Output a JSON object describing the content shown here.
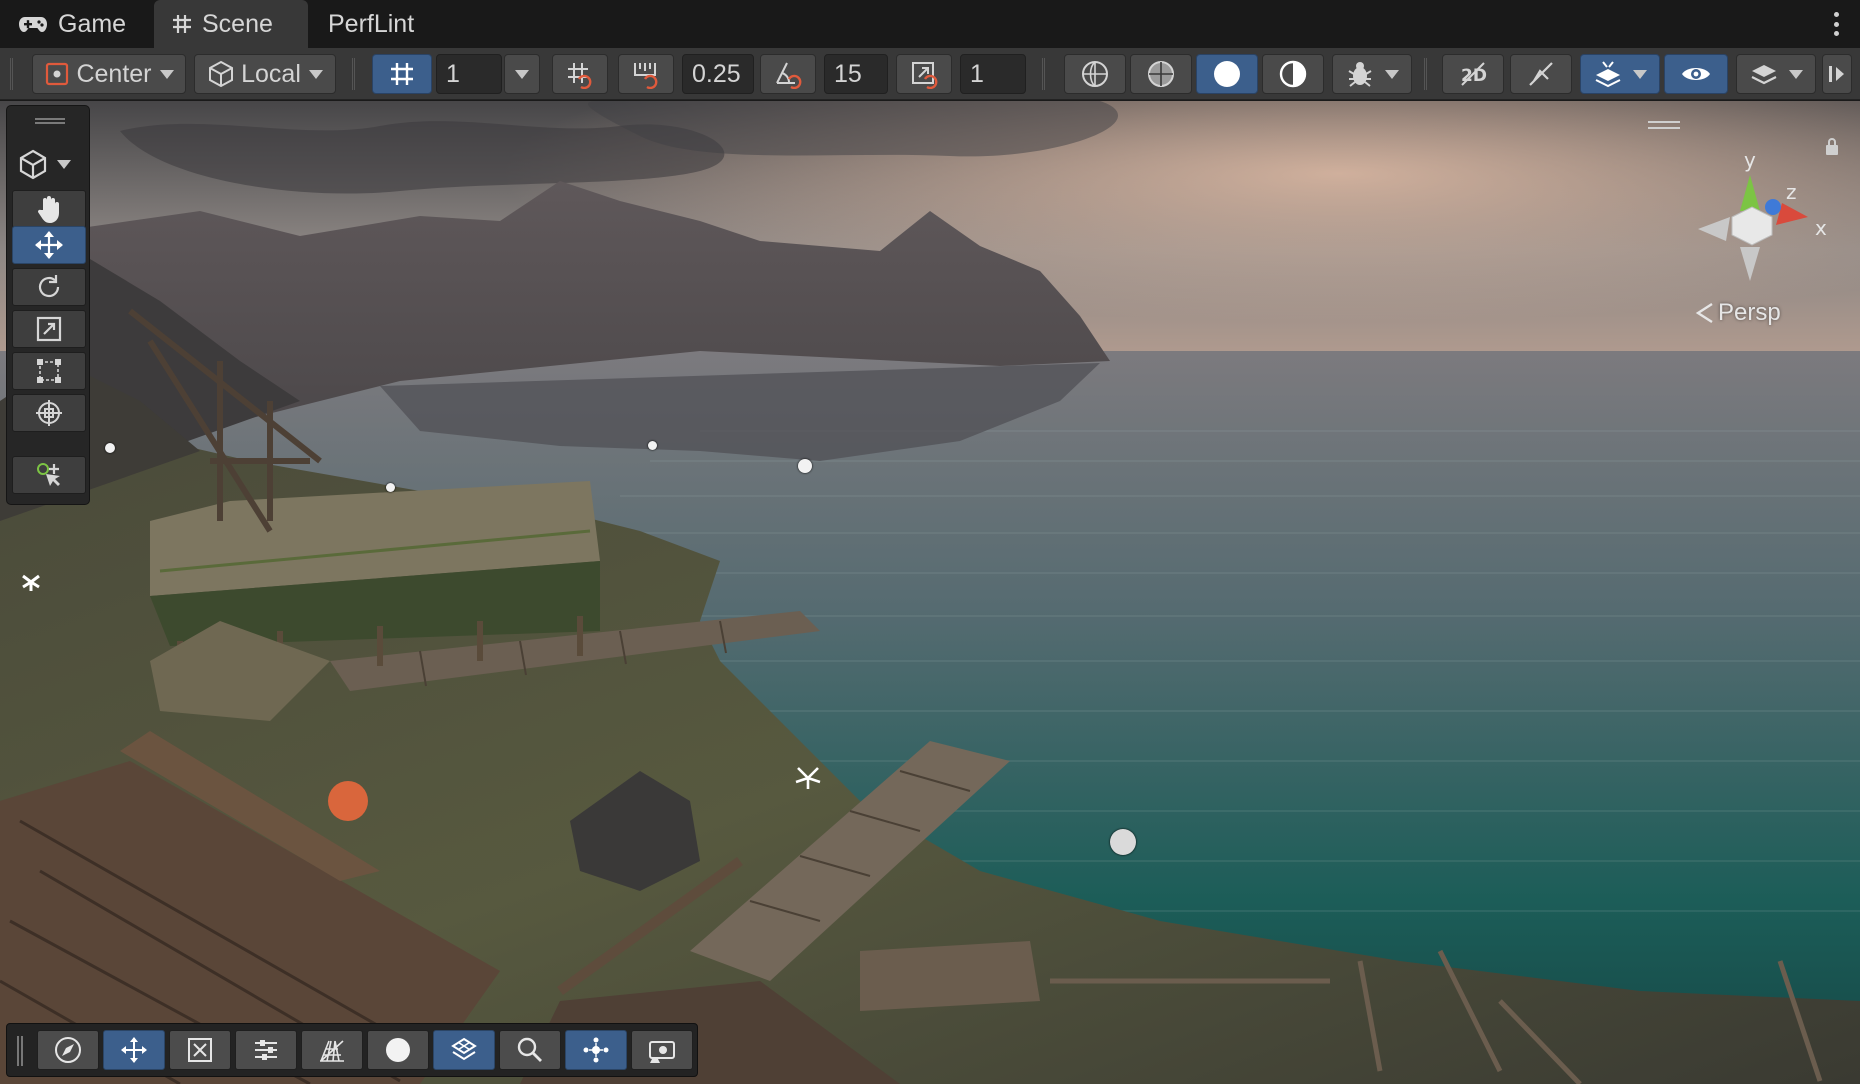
{
  "tabs": [
    {
      "label": "Game",
      "icon": "gamepad-icon"
    },
    {
      "label": "Scene",
      "icon": "grid-hash-icon"
    },
    {
      "label": "PerfLint",
      "icon": ""
    }
  ],
  "active_tab": "Scene",
  "toolbar": {
    "pivot_mode": "Center",
    "pivot_rotation": "Local",
    "grid_size_value": "1",
    "move_snap_value": "0.25",
    "rotate_snap_value": "15",
    "scale_snap_value": "1"
  },
  "scene_view": {
    "projection_label": "Persp",
    "gizmo_axes": {
      "y": "y",
      "z": "z",
      "x": "x"
    }
  },
  "colors": {
    "accent": "#3c5f8c",
    "axis_x": "#d94a3c",
    "axis_y": "#7cc444",
    "axis_z": "#3f7ad8"
  }
}
